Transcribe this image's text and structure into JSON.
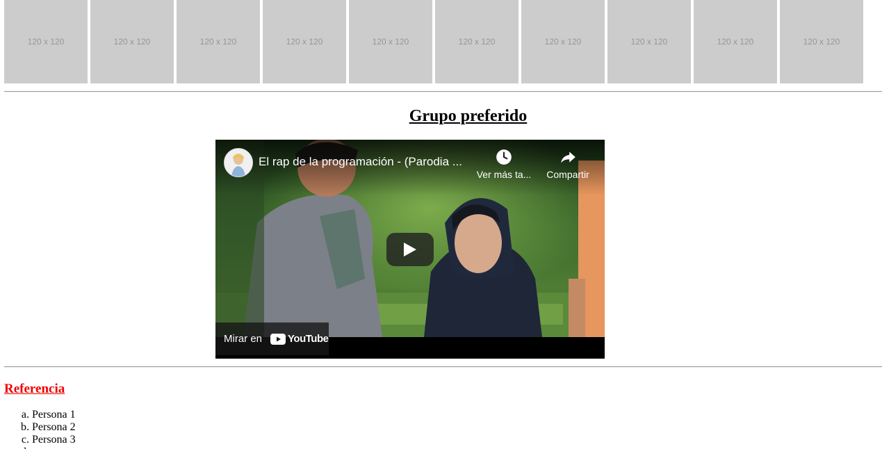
{
  "thumbnails": [
    {
      "label": "120 x 120"
    },
    {
      "label": "120 x 120"
    },
    {
      "label": "120 x 120"
    },
    {
      "label": "120 x 120"
    },
    {
      "label": "120 x 120"
    },
    {
      "label": "120 x 120"
    },
    {
      "label": "120 x 120"
    },
    {
      "label": "120 x 120"
    },
    {
      "label": "120 x 120"
    },
    {
      "label": "120 x 120"
    }
  ],
  "section": {
    "title": "Grupo preferido"
  },
  "video": {
    "title": "El rap de la programación - (Parodia ...",
    "watch_later_label": "Ver más ta...",
    "share_label": "Compartir",
    "watch_on_label": "Mirar en",
    "brand": "YouTube",
    "colors": {
      "brand_red": "#ff0000",
      "overlay": "#171717"
    },
    "icons": {
      "watch_later": "clock-icon",
      "share": "share-arrow-icon",
      "play": "play-icon"
    }
  },
  "references": {
    "title": "Referencia",
    "title_color": "#ee0000",
    "items": [
      {
        "label": "Persona 1"
      },
      {
        "label": "Persona 2"
      },
      {
        "label": "Persona 3"
      },
      {
        "label": ""
      }
    ]
  }
}
